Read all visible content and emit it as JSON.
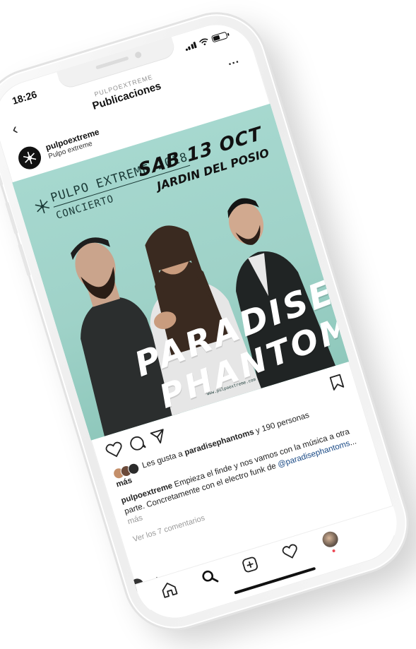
{
  "status_bar": {
    "time": "18:26"
  },
  "nav": {
    "subtitle": "PULPOEXTREME",
    "title": "Publicaciones",
    "back_icon": "chevron-left-icon",
    "more_label": "..."
  },
  "post": {
    "username": "pulpoextreme",
    "location": "Pulpo extreme",
    "poster": {
      "event_title": "PULPO EXTREME 2018",
      "event_type": "CONCIERTO",
      "date": "SAB 13 OCT",
      "venue": "JARDIN DEL POSIO",
      "band_line1": "PARADISE",
      "band_line2": "PHANTOMS",
      "website": "www.pulpoextreme.com"
    },
    "likes_prefix": "Les gusta a ",
    "likes_user": "paradisephantoms",
    "likes_suffix": " y 190 personas",
    "likes_more": "más",
    "caption_user": "pulpoextreme",
    "caption_text": " Empieza el finde y nos vamos con la música a otra parte. Concretamente con el electro funk de ",
    "caption_mention": "@paradisephantoms",
    "caption_ellipsis": "...",
    "caption_more": " más",
    "comments_link": "Ver los 7 comentarios"
  },
  "next_post": {
    "username": "pulpoextreme"
  },
  "tabbar": {
    "items": [
      "home-icon",
      "search-icon",
      "add-post-icon",
      "heart-icon",
      "profile-avatar"
    ]
  },
  "colors": {
    "poster_bg": "#9fd2c8",
    "mention": "#1a4a86"
  }
}
